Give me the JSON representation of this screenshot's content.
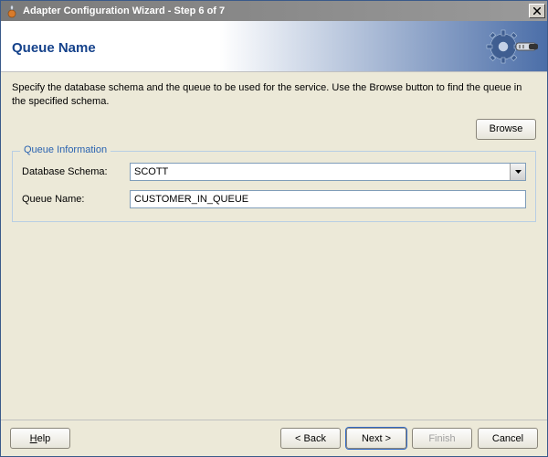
{
  "window": {
    "title": "Adapter Configuration Wizard - Step 6 of 7"
  },
  "page": {
    "title": "Queue Name",
    "instructions": "Specify the database schema and the queue to be used for the service. Use the Browse button to find the queue in the specified schema."
  },
  "buttons": {
    "browse": "Browse",
    "help": "Help",
    "back": "< Back",
    "next": "Next >",
    "finish": "Finish",
    "cancel": "Cancel"
  },
  "group": {
    "legend": "Queue Information",
    "schema_label": "Database Schema:",
    "schema_value": "SCOTT",
    "queue_label": "Queue Name:",
    "queue_value": "CUSTOMER_IN_QUEUE"
  }
}
